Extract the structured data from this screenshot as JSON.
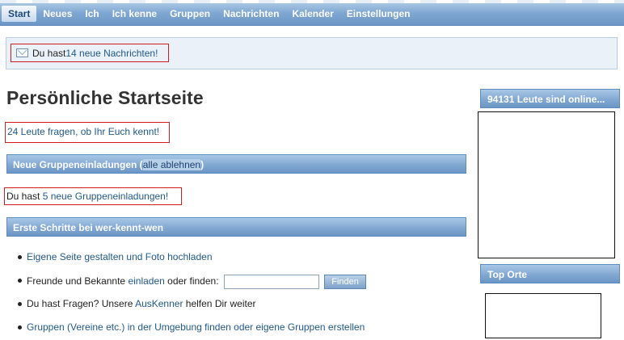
{
  "nav": {
    "items": [
      {
        "label": "Start",
        "active": true
      },
      {
        "label": "Neues"
      },
      {
        "label": "Ich"
      },
      {
        "label": "Ich kenne"
      },
      {
        "label": "Gruppen"
      },
      {
        "label": "Nachrichten"
      },
      {
        "label": "Kalender"
      },
      {
        "label": "Einstellungen"
      }
    ]
  },
  "messages": {
    "icon": "envelope-icon",
    "prefix": "Du hast ",
    "link": "14 neue Nachrichten!"
  },
  "page_title": "Persönliche Startseite",
  "people_question": "24 Leute fragen, ob Ihr Euch kennt!",
  "group_invites": {
    "heading": "Neue Gruppeneinladungen (",
    "decline_all": "alle ablehnen",
    "heading_close": ")",
    "text_prefix": "Du hast ",
    "text_link": "5 neue Gruppeneinladungen!"
  },
  "first_steps": {
    "heading": "Erste Schritte bei wer-kennt-wen",
    "step1_link": "Eigene Seite gestalten und Foto hochladen",
    "step2_prefix": "Freunde und Bekannte ",
    "step2_link": "einladen",
    "step2_suffix": " oder finden:",
    "find_button": "Finden",
    "step3_prefix": "Du hast Fragen? Unsere ",
    "step3_link": "AusKenner",
    "step3_suffix": " helfen Dir weiter",
    "step4_link": "Gruppen (Vereine etc.) in der Umgebung finden oder eigene Gruppen erstellen"
  },
  "sidebar": {
    "online_heading": "94131 Leute sind online...",
    "top_places_heading": "Top Orte"
  },
  "colors": {
    "link": "#215a8c",
    "highlight_border": "#d11c1c",
    "header_blue": "#7fa6d0"
  }
}
